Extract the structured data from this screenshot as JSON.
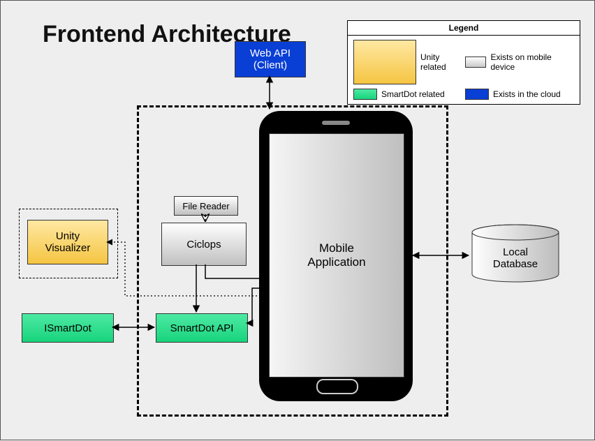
{
  "title": "Frontend\nArchitecture",
  "legend": {
    "header": "Legend",
    "items": [
      {
        "label": "Unity related"
      },
      {
        "label": "Exists on mobile device"
      },
      {
        "label": "SmartDot related"
      },
      {
        "label": "Exists in the cloud"
      }
    ]
  },
  "nodes": {
    "web_api": "Web API\n(Client)",
    "mobile_app": "Mobile\nApplication",
    "file_reader": "File Reader",
    "ciclops": "Ciclops",
    "unity_viz": "Unity\nVisualizer",
    "smartdot_api": "SmartDot API",
    "ismartdot": "ISmartDot",
    "local_db": "Local\nDatabase"
  },
  "edges": [
    {
      "from": "web_api",
      "to": "mobile_app",
      "dir": "both",
      "style": "solid"
    },
    {
      "from": "mobile_app",
      "to": "local_db",
      "dir": "both",
      "style": "solid"
    },
    {
      "from": "file_reader",
      "to": "ciclops",
      "dir": "one",
      "style": "dashed"
    },
    {
      "from": "ciclops",
      "to": "mobile_app",
      "dir": "one",
      "style": "solid"
    },
    {
      "from": "ciclops",
      "to": "smartdot_api",
      "dir": "one",
      "style": "solid"
    },
    {
      "from": "smartdot_api",
      "to": "mobile_app",
      "dir": "both",
      "style": "solid"
    },
    {
      "from": "smartdot_api",
      "to": "ismartdot",
      "dir": "both",
      "style": "solid"
    },
    {
      "from": "unity_viz",
      "to": "mobile_app",
      "dir": "both",
      "style": "dotted"
    }
  ]
}
